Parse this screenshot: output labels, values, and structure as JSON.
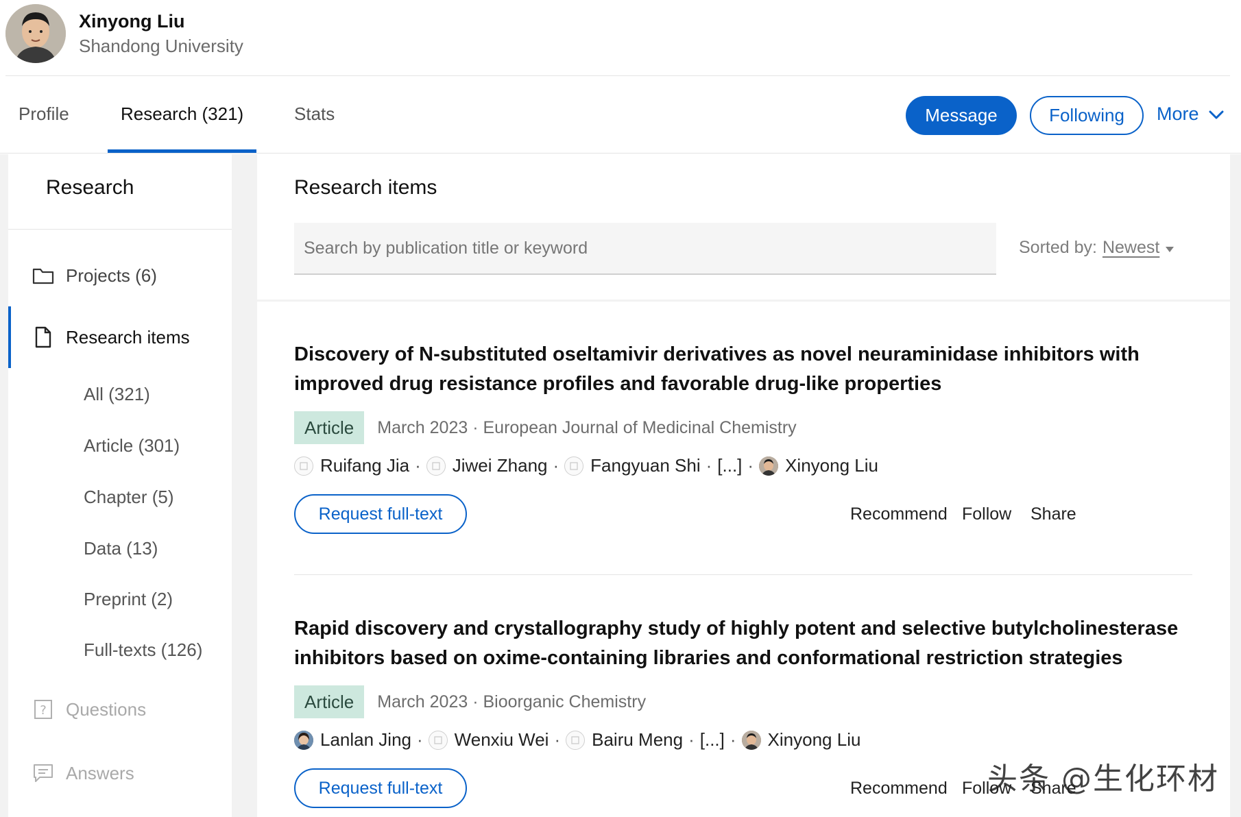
{
  "profile": {
    "name": "Xinyong Liu",
    "institution": "Shandong University"
  },
  "tabs": [
    {
      "label": "Profile"
    },
    {
      "label": "Research (321)"
    },
    {
      "label": "Stats"
    }
  ],
  "header_actions": {
    "message_label": "Message",
    "following_label": "Following",
    "more_label": "More"
  },
  "sidebar": {
    "title": "Research",
    "projects_label": "Projects (6)",
    "research_items_label": "Research items",
    "sub_items": [
      {
        "label": "All (321)"
      },
      {
        "label": "Article (301)"
      },
      {
        "label": "Chapter (5)"
      },
      {
        "label": "Data (13)"
      },
      {
        "label": "Preprint (2)"
      },
      {
        "label": "Full-texts (126)"
      }
    ],
    "questions_label": "Questions",
    "answers_label": "Answers"
  },
  "main": {
    "title": "Research items",
    "search_placeholder": "Search by publication title or keyword",
    "sort_label": "Sorted by:",
    "sort_value": "Newest"
  },
  "items": [
    {
      "title": "Discovery of N-substituted oseltamivir derivatives as novel neuraminidase inhibitors with improved drug resistance profiles and favorable drug-like properties",
      "type": "Article",
      "meta": "March 2023 · European Journal of Medicinal Chemistry",
      "authors": [
        "Ruifang Jia",
        "Jiwei Zhang",
        "Fangyuan Shi",
        "[...]",
        "Xinyong Liu"
      ],
      "request_label": "Request full-text",
      "recommend_label": "Recommend",
      "follow_label": "Follow",
      "share_label": "Share"
    },
    {
      "title": "Rapid discovery and crystallography study of highly potent and selective butylcholinesterase inhibitors based on oxime-containing libraries and conformational restriction strategies",
      "type": "Article",
      "meta": "March 2023 · Bioorganic Chemistry",
      "authors": [
        "Lanlan Jing",
        "Wenxiu Wei",
        "Bairu Meng",
        "[...]",
        "Xinyong Liu"
      ],
      "request_label": "Request full-text",
      "recommend_label": "Recommend",
      "follow_label": "Follow",
      "share_label": "Share"
    }
  ],
  "watermark": "头条 @生化环材",
  "colors": {
    "accent": "#0a62c9",
    "badge_bg": "#cde8de",
    "page_bg": "#f2f2f2"
  }
}
